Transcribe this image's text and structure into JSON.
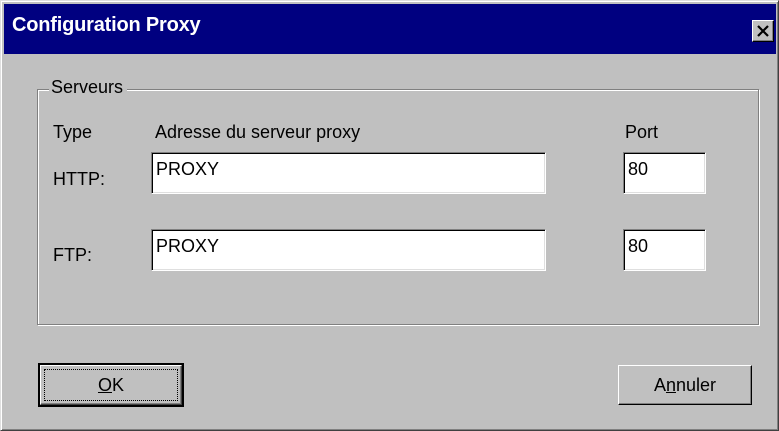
{
  "window": {
    "title": "Configuration Proxy"
  },
  "group": {
    "legend": "Serveurs"
  },
  "columns": {
    "type": "Type",
    "address": "Adresse du serveur proxy",
    "port": "Port"
  },
  "rows": [
    {
      "label": "HTTP:",
      "address": "PROXY",
      "port": "80"
    },
    {
      "label": "FTP:",
      "address": "PROXY",
      "port": "80"
    }
  ],
  "buttons": {
    "ok": {
      "accel": "O",
      "rest": "K"
    },
    "cancel": {
      "pre": "A",
      "accel": "n",
      "rest": "nuler"
    }
  },
  "colors": {
    "titlebar": "#000080",
    "face": "#c0c0c0"
  },
  "icons": {
    "close": "close-icon"
  }
}
